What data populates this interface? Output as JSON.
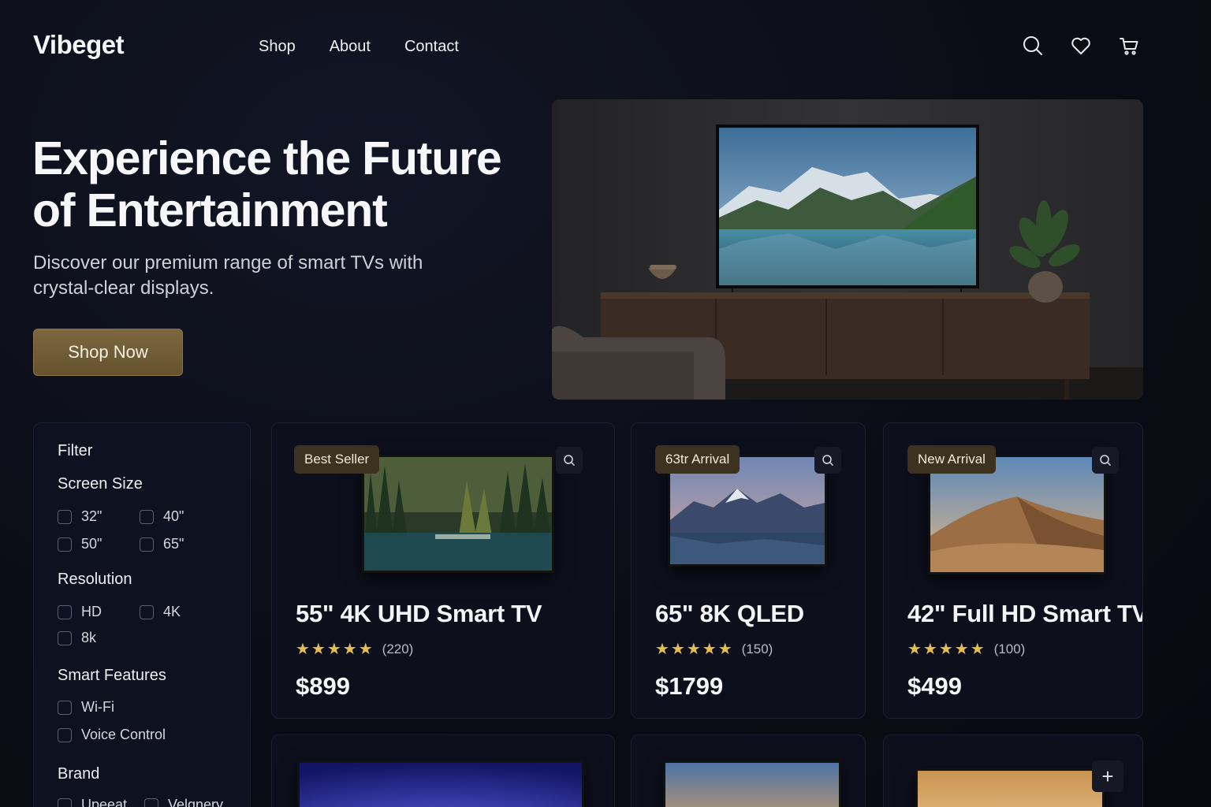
{
  "header": {
    "logo": "Vibeget",
    "nav": [
      "Shop",
      "About",
      "Contact"
    ],
    "icons": [
      "search-icon",
      "heart-icon",
      "cart-icon"
    ]
  },
  "hero": {
    "title": "Experience the Future of Entertainment",
    "subtitle": "Discover our premium range of smart TVs with crystal-clear displays.",
    "cta": "Shop Now"
  },
  "filters": {
    "title": "Filter",
    "groups": [
      {
        "title": "Screen Size",
        "options": [
          "32\"",
          "40\"",
          "50\"",
          "65\""
        ]
      },
      {
        "title": "Resolution",
        "options": [
          "HD",
          "4K",
          "8k"
        ]
      },
      {
        "title": "Smart Features",
        "options": [
          "Wi-Fi",
          "Voice Control"
        ]
      },
      {
        "title": "Brand",
        "options": [
          "Upeeat",
          "Velgnery"
        ]
      }
    ]
  },
  "products": [
    {
      "badge": "Best Seller",
      "title": "55\" 4K UHD Smart TV",
      "stars": "★★★★★",
      "reviews": "(220)",
      "price": "$899"
    },
    {
      "badge": "63tr Arrival",
      "title": "65\" 8K QLED",
      "stars": "★★★★★",
      "reviews": "(150)",
      "price": "$1799"
    },
    {
      "badge": "New Arrival",
      "title": "42\" Full HD Smart TV",
      "stars": "★★★★★",
      "reviews": "(100)",
      "price": "$499"
    }
  ],
  "second_row": {
    "add_label": "+"
  },
  "colors": {
    "accent": "#6f5b34",
    "star": "#e3bf55",
    "background": "#0b0d16"
  }
}
